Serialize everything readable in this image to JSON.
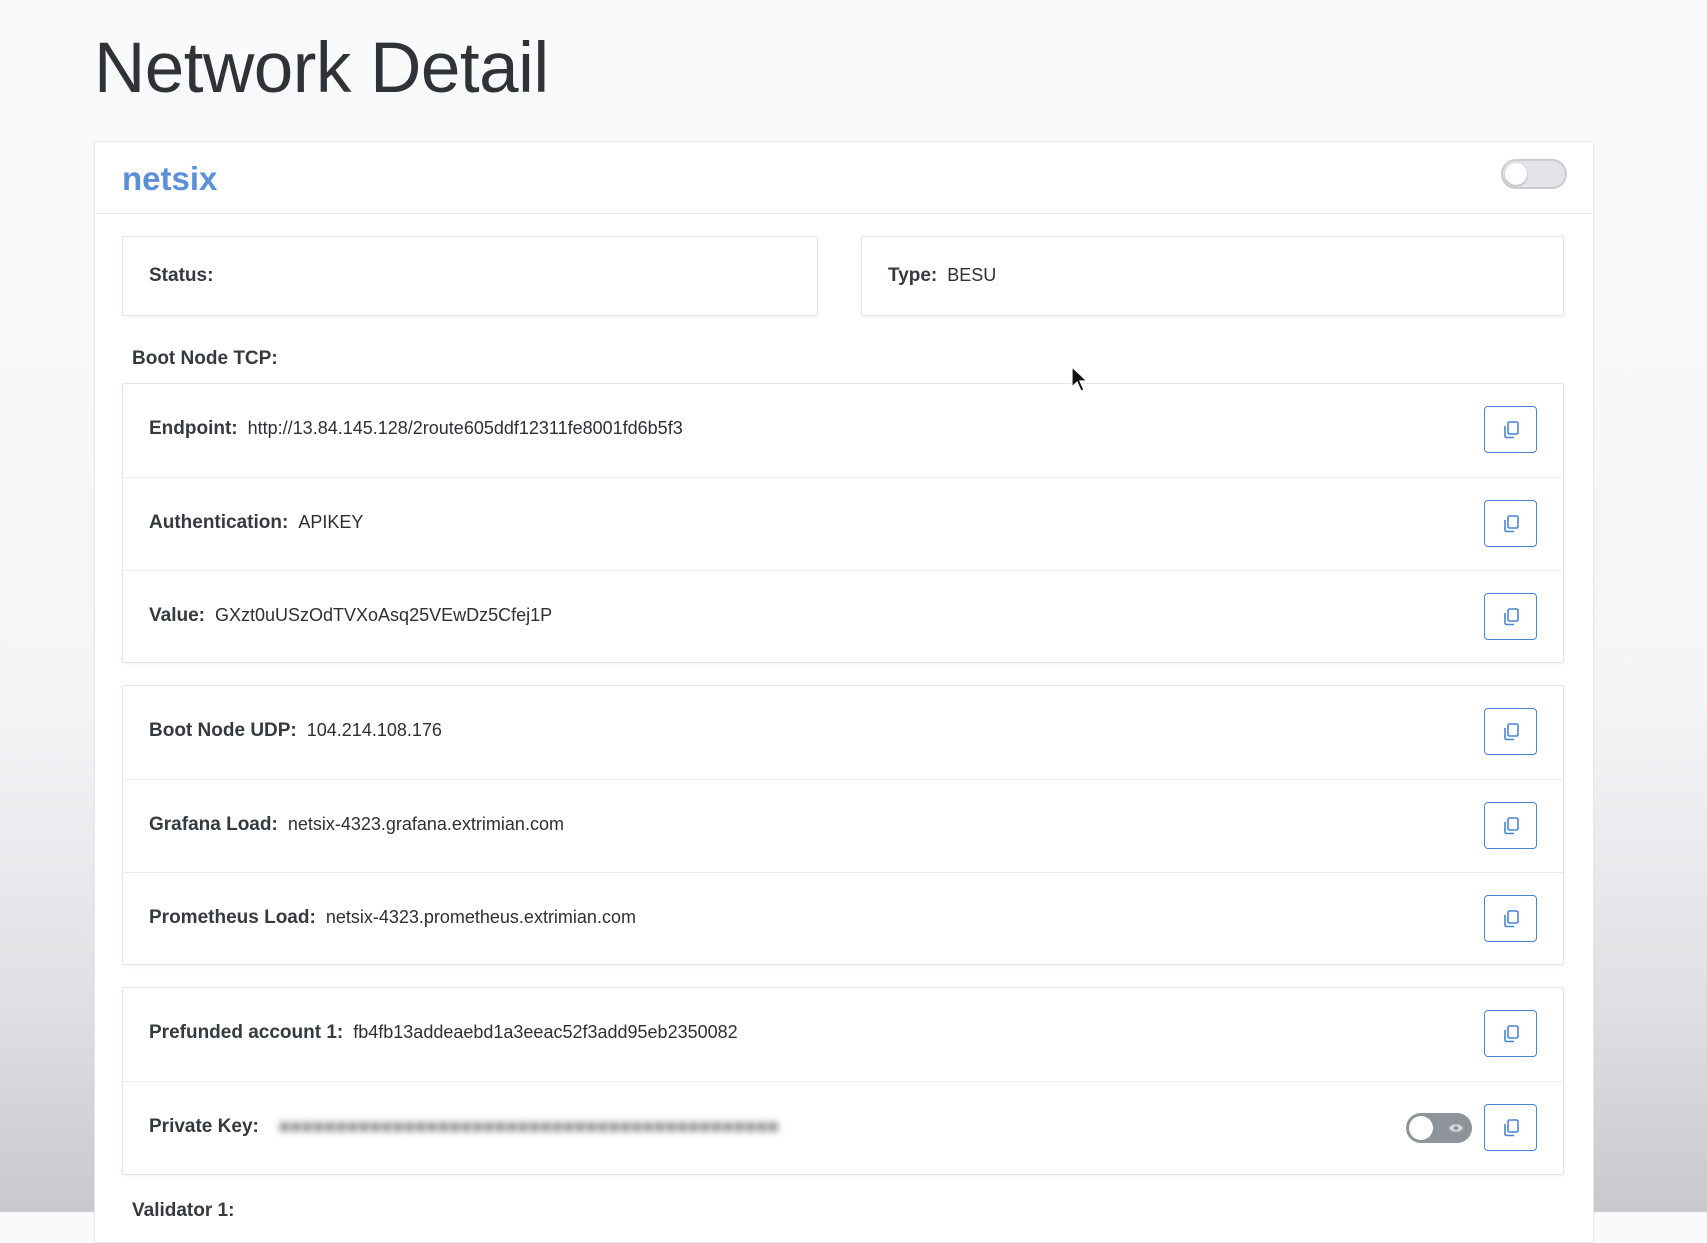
{
  "page": {
    "title": "Network Detail"
  },
  "network": {
    "name": "netsix"
  },
  "status": {
    "label": "Status:",
    "value": ""
  },
  "type": {
    "label": "Type:",
    "value": "BESU"
  },
  "boot_node_tcp": {
    "section_label": "Boot Node TCP:",
    "rows": [
      {
        "label": "Endpoint:",
        "value": "http://13.84.145.128/2route605ddf12311fe8001fd6b5f3"
      },
      {
        "label": "Authentication:",
        "value": "APIKEY"
      },
      {
        "label": "Value:",
        "value": "GXzt0uUSzOdTVXoAsq25VEwDz5Cfej1P"
      }
    ]
  },
  "node_info": {
    "rows": [
      {
        "label": "Boot Node UDP:",
        "value": "104.214.108.176"
      },
      {
        "label": "Grafana Load:",
        "value": "netsix-4323.grafana.extrimian.com"
      },
      {
        "label": "Prometheus Load:",
        "value": "netsix-4323.prometheus.extrimian.com"
      }
    ]
  },
  "accounts": {
    "rows": [
      {
        "label": "Prefunded account 1:",
        "value": "fb4fb13addeaebd1a3eeac52f3add95eb2350082"
      },
      {
        "label": "Private Key:",
        "value": ""
      }
    ]
  },
  "validator": {
    "section_label": "Validator 1:"
  },
  "icons": {
    "copy": "copy-icon",
    "eye": "eye-icon",
    "cursor": "mouse-cursor"
  },
  "colors": {
    "accent": "#4a83d3",
    "network_name": "#5b8fd9"
  }
}
